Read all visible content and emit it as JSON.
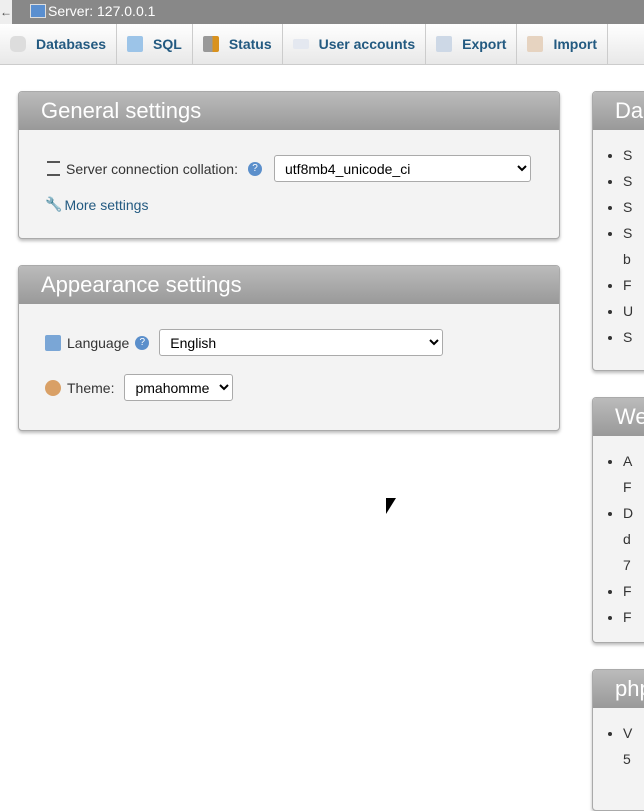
{
  "topbar": {
    "back": "←",
    "title": "Server: 127.0.0.1"
  },
  "tabs": [
    {
      "label": "Databases",
      "icon": "database-icon"
    },
    {
      "label": "SQL",
      "icon": "sql-icon"
    },
    {
      "label": "Status",
      "icon": "status-icon"
    },
    {
      "label": "User accounts",
      "icon": "users-icon"
    },
    {
      "label": "Export",
      "icon": "export-icon"
    },
    {
      "label": "Import",
      "icon": "import-icon"
    }
  ],
  "general": {
    "title": "General settings",
    "collation_label": "Server connection collation:",
    "collation_value": "utf8mb4_unicode_ci",
    "more": "More settings"
  },
  "appearance": {
    "title": "Appearance settings",
    "language_label": "Language",
    "language_value": "English",
    "theme_label": "Theme:",
    "theme_value": "pmahomme"
  },
  "right": [
    {
      "title": "Da",
      "items": [
        "S",
        "S",
        "S",
        "S\nb",
        "F",
        "U",
        "S"
      ]
    },
    {
      "title": "We",
      "items": [
        "A\nF",
        "D\nd\n7",
        "F",
        "F"
      ]
    },
    {
      "title": "php",
      "items": [
        "V\n5"
      ]
    }
  ]
}
